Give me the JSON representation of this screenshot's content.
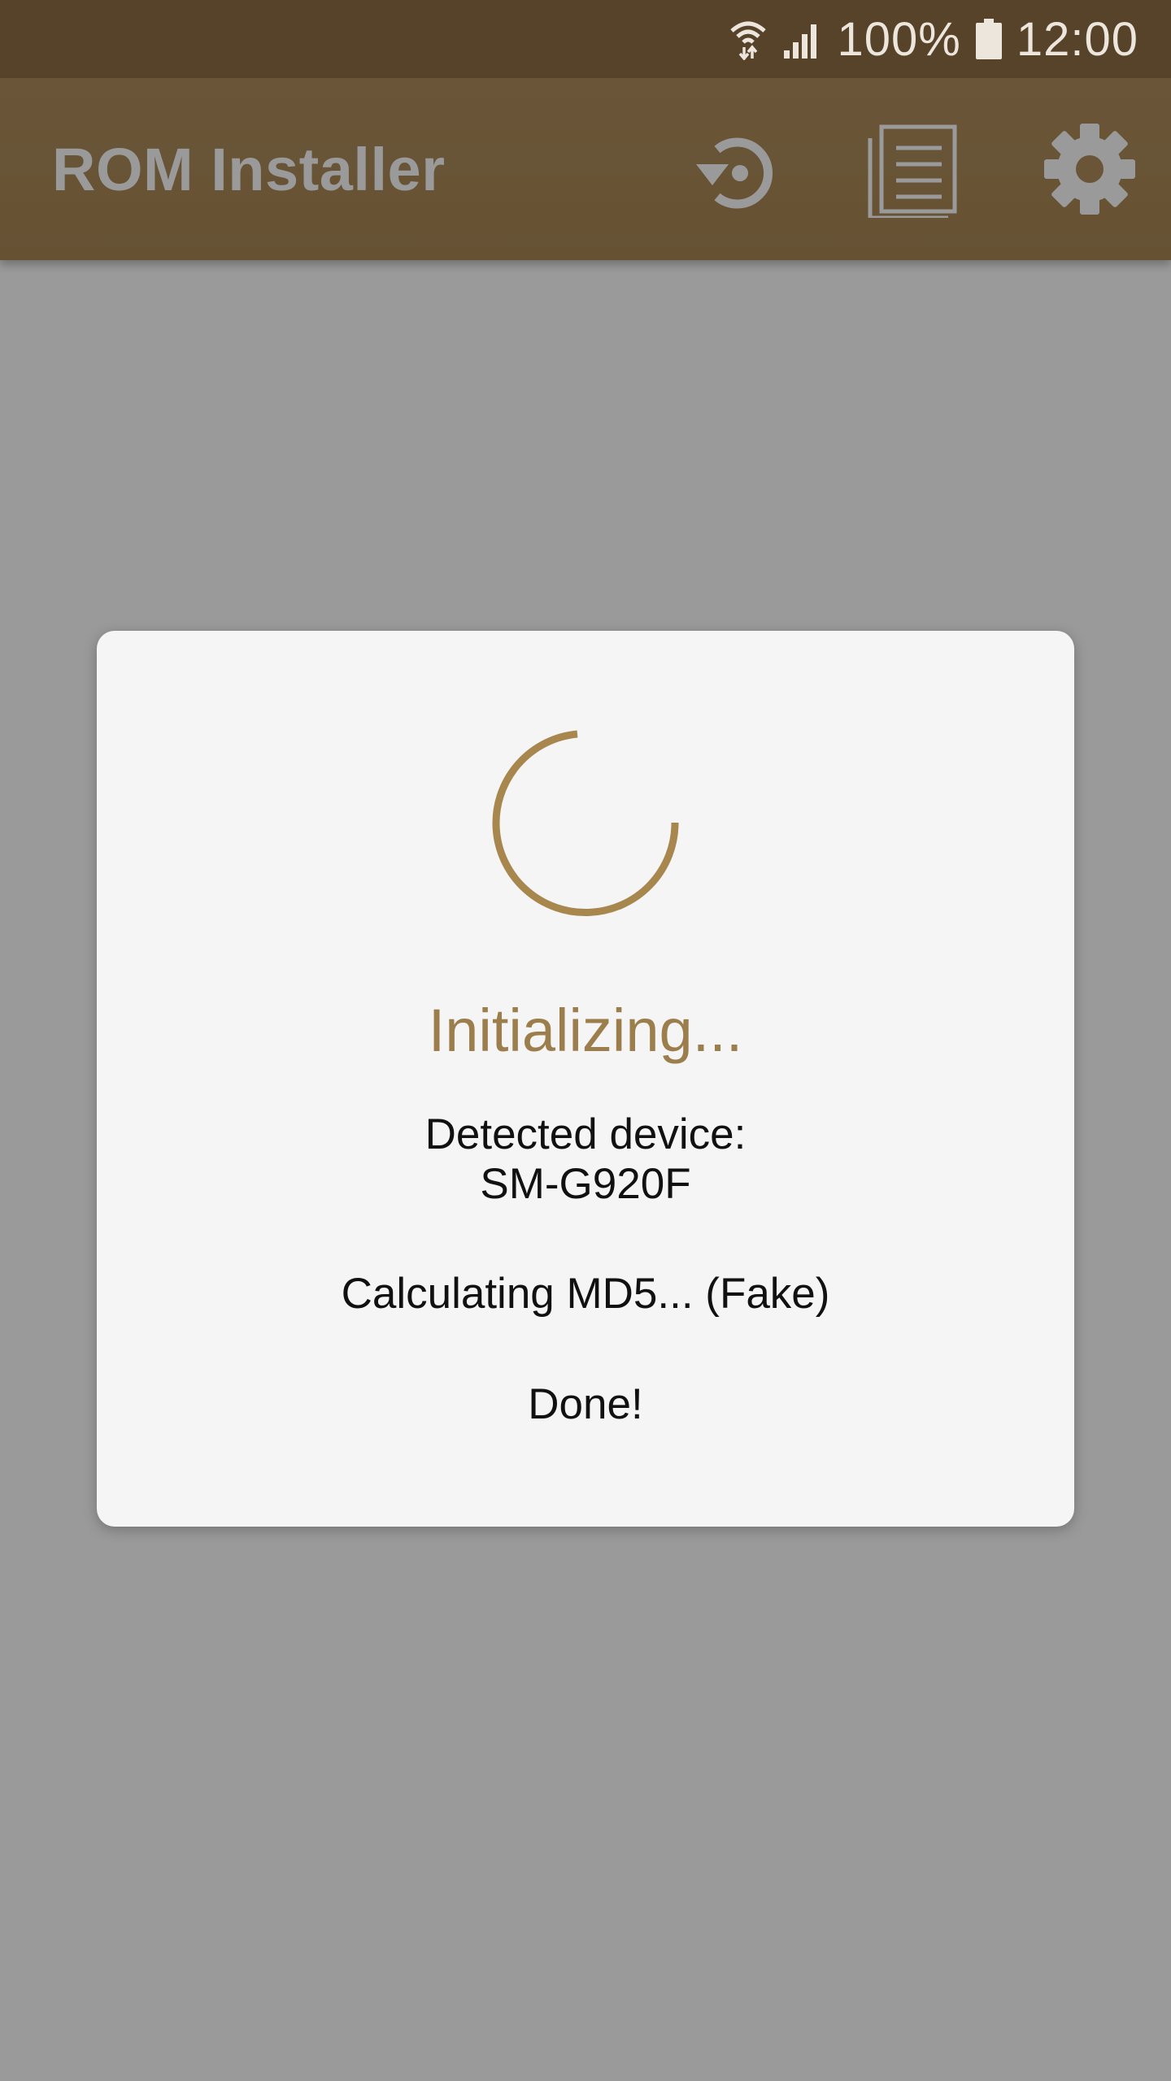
{
  "status_bar": {
    "battery": "100%",
    "time": "12:00",
    "icons": [
      "wifi-icon",
      "signal-icon",
      "battery-icon"
    ]
  },
  "app_bar": {
    "title": "ROM Installer",
    "actions": [
      "restore-icon",
      "log-icon",
      "settings-icon"
    ]
  },
  "dialog": {
    "title": "Initializing...",
    "detected_label": "Detected device:",
    "device_model": "SM-G920F",
    "md5_status": "Calculating MD5... (Fake)",
    "done_text": "Done!"
  },
  "colors": {
    "status_bar": "#56432a",
    "app_bar": "#6a5538",
    "accent": "#a8874f",
    "scrim_background": "#9a9a9a",
    "dialog_background": "#f5f5f5"
  }
}
